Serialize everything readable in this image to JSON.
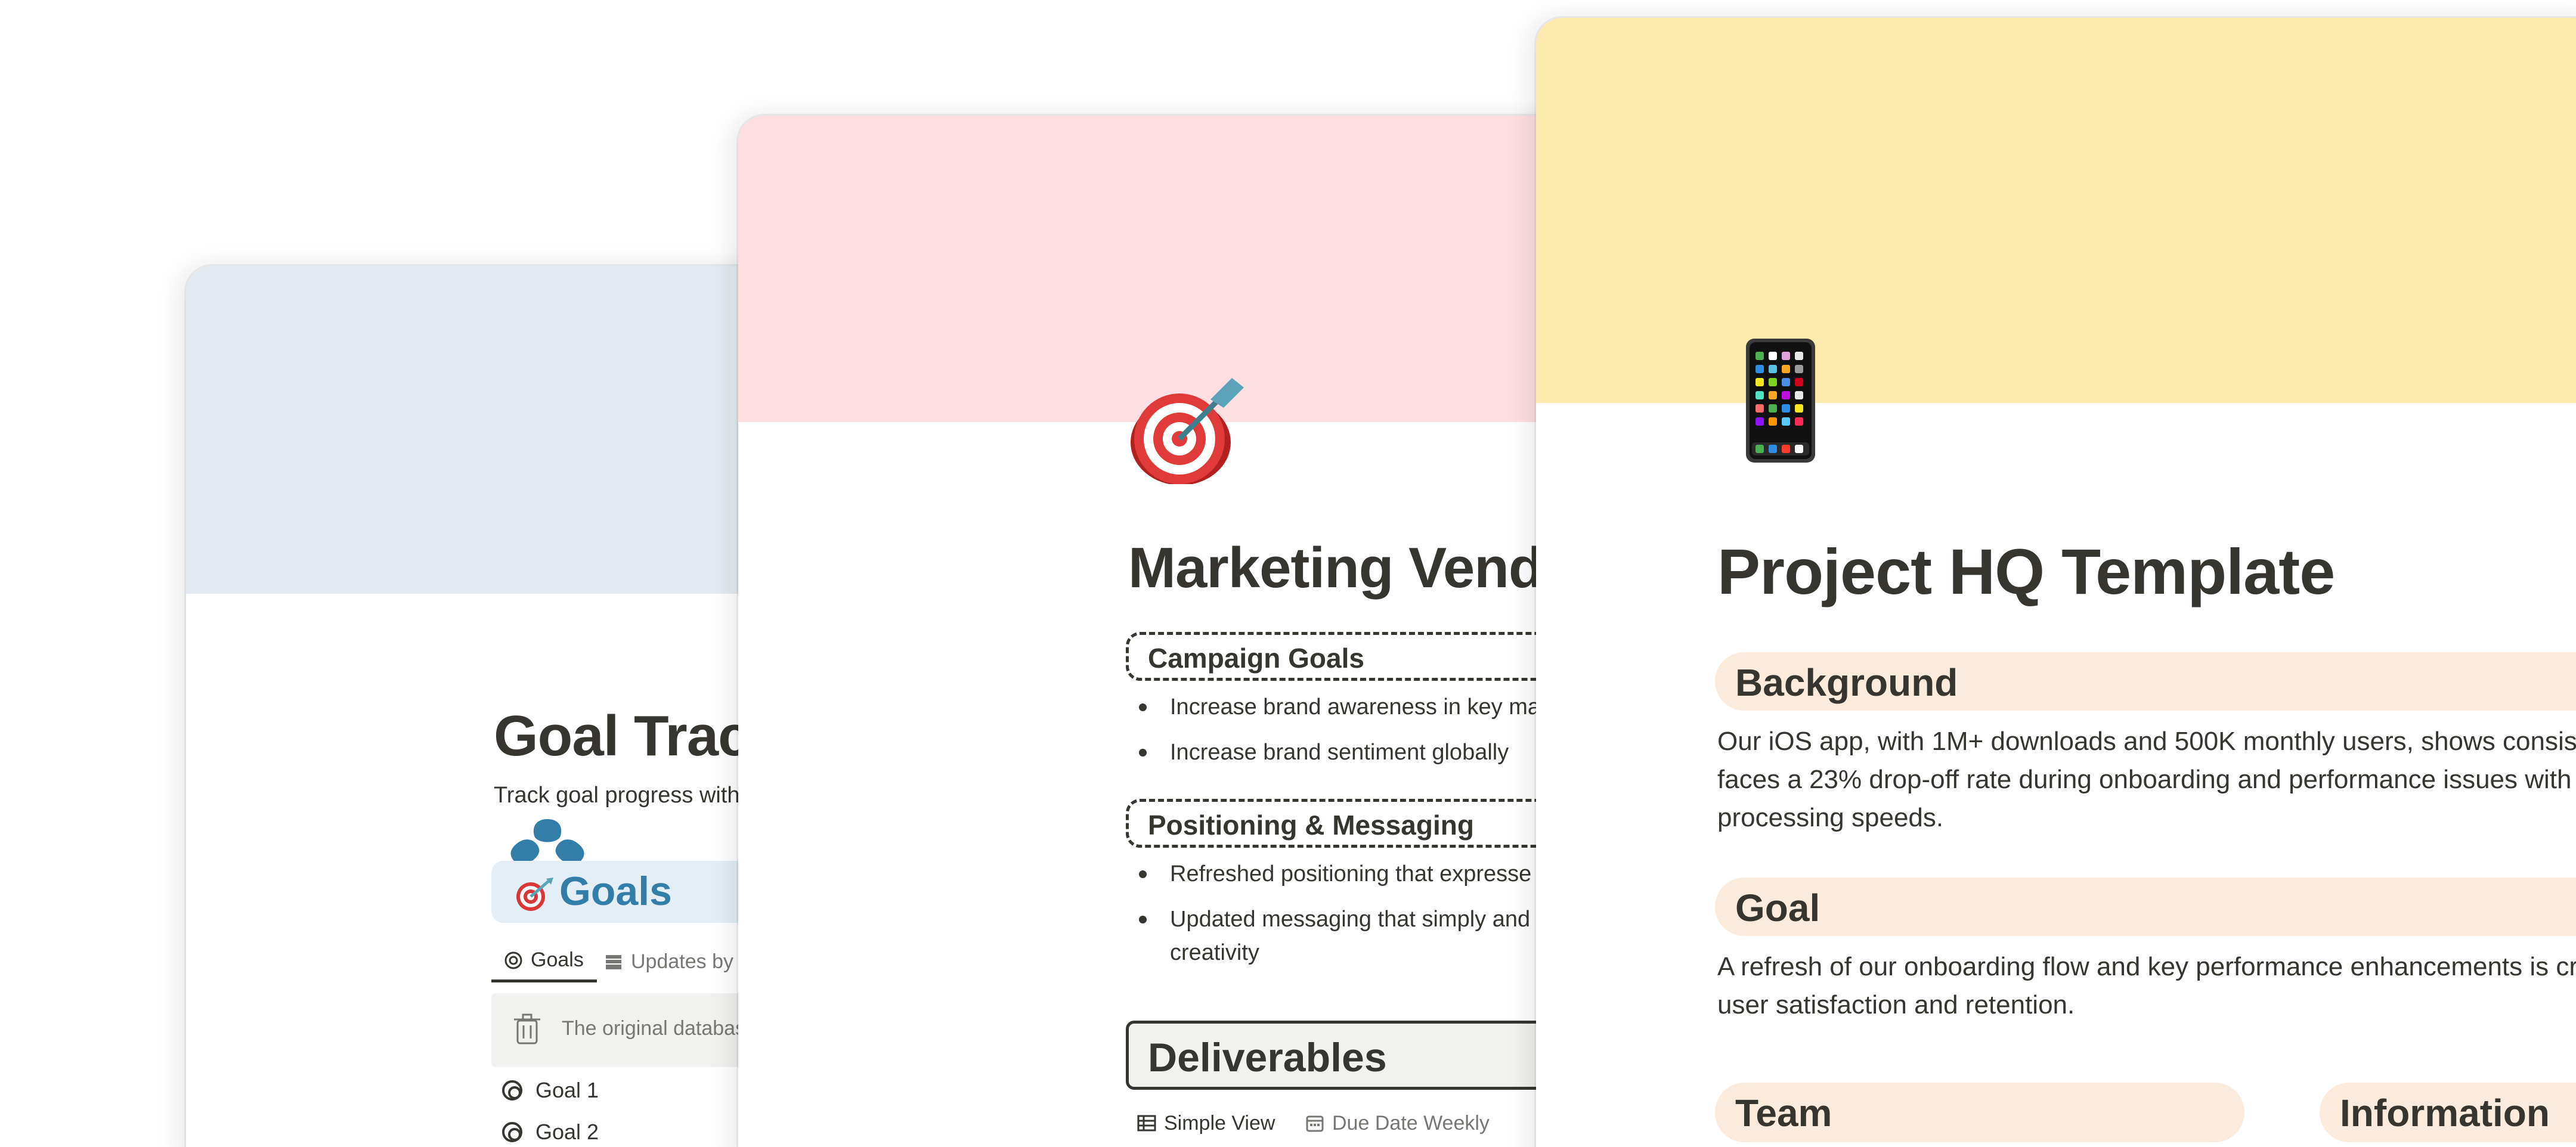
{
  "cards": {
    "goal_tracker": {
      "title": "Goal Track",
      "description": "Track goal progress with",
      "goals_heading": "Goals",
      "tabs": [
        "Goals",
        "Updates by"
      ],
      "callout": "The original database",
      "items": [
        "Goal 1",
        "Goal 2"
      ],
      "icons": {
        "page": "flower-icon",
        "heading": "dart-target-icon"
      }
    },
    "marketing": {
      "title": "Marketing Vend",
      "sections": [
        {
          "heading": "Campaign Goals",
          "bullets": [
            "Increase brand awareness in key ma",
            "Increase brand sentiment globally"
          ]
        },
        {
          "heading": "Positioning & Messaging",
          "bullets": [
            "Refreshed positioning that expresse",
            "Updated messaging that simply and creativity"
          ]
        }
      ],
      "bullet_lines": {
        "positioning_2_line1": "Updated messaging that simply and",
        "positioning_2_line2": "creativity"
      },
      "deliverables": "Deliverables",
      "tabs": [
        "Simple View",
        "Due Date Weekly"
      ],
      "icons": {
        "page": "dart-target-icon"
      }
    },
    "project_hq": {
      "title": "Project HQ Template",
      "background_heading": "Background",
      "background_text": [
        "Our iOS app, with 1M+ downloads and 500K monthly users, shows consist",
        "faces a 23% drop-off rate during onboarding and performance issues with",
        "processing speeds."
      ],
      "goal_heading": "Goal",
      "goal_text": [
        "A refresh of our onboarding flow and key performance enhancements is cr",
        "user satisfaction and retention."
      ],
      "team_heading": "Team",
      "information_heading": "Information",
      "icons": {
        "page": "mobile-phone-icon"
      }
    }
  },
  "colors": {
    "goal_cover": "#e3eaf1",
    "marketing_cover": "#fddfe2",
    "project_cover": "#fdebad",
    "heading_bar": "#faebdd",
    "goals_blue": "#337ea9"
  }
}
